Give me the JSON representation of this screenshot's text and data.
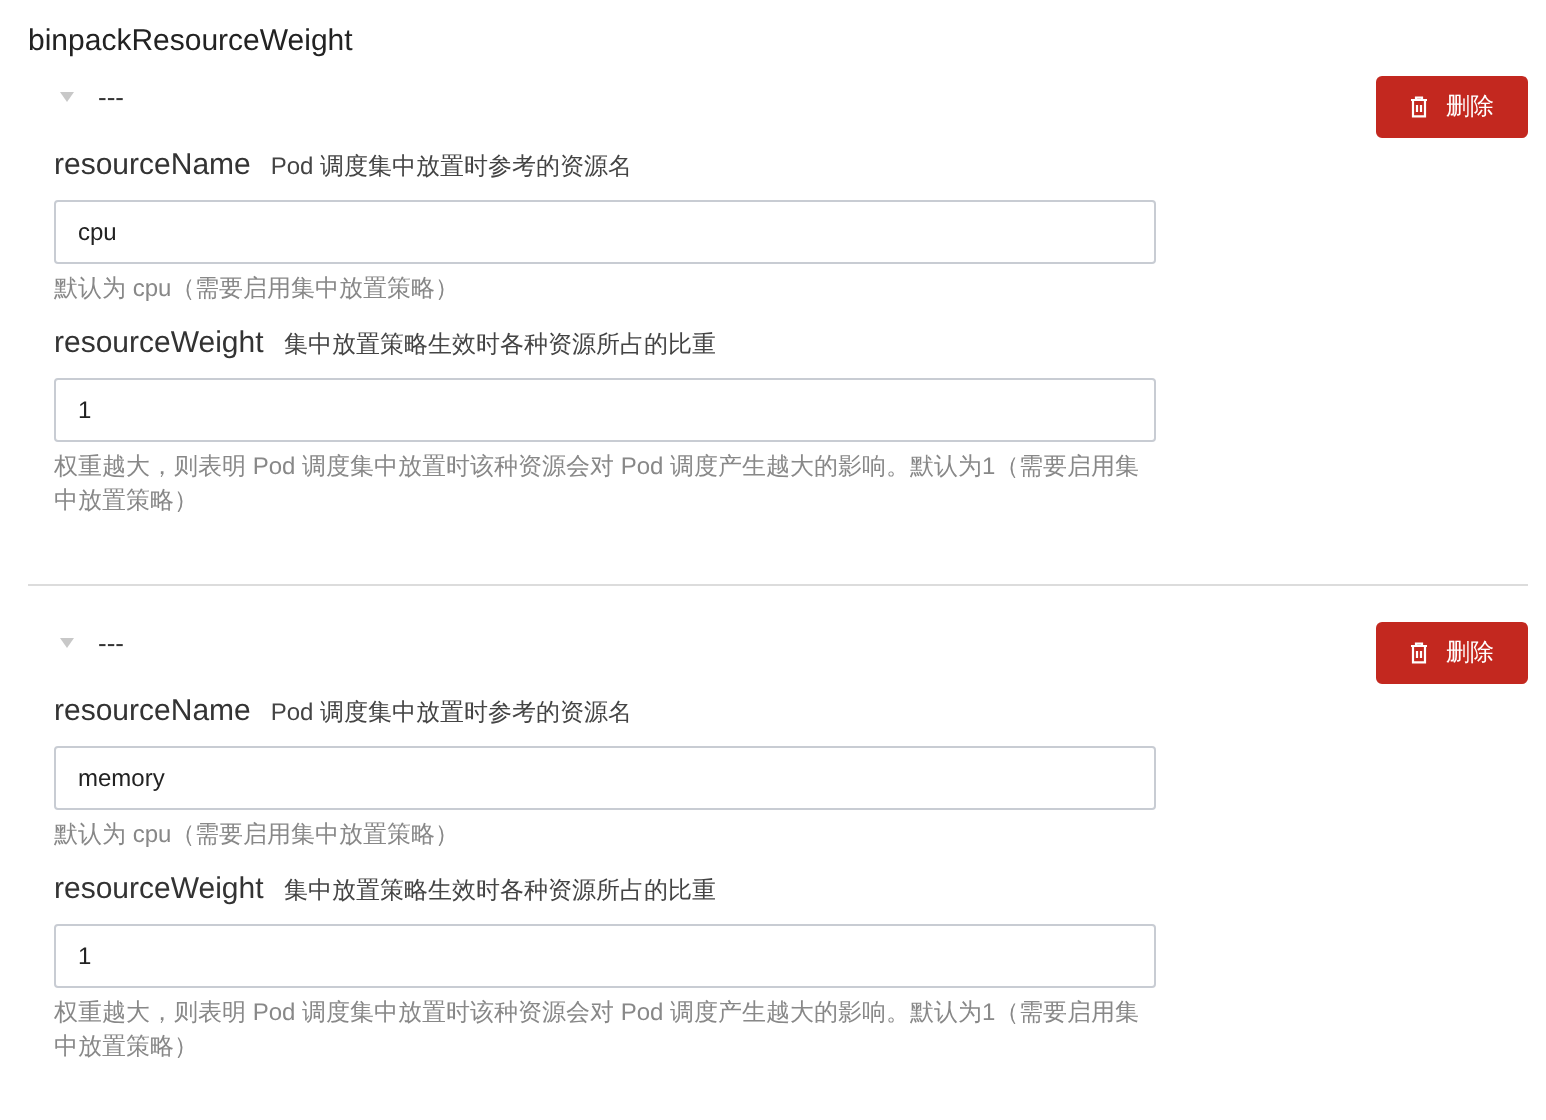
{
  "title": "binpackResourceWeight",
  "items": [
    {
      "header": "---",
      "expanded": true,
      "delete_button": "删除",
      "fields": [
        {
          "name": "resourceName",
          "description": "Pod 调度集中放置时参考的资源名",
          "value": "cpu",
          "help": "默认为 cpu（需要启用集中放置策略）"
        },
        {
          "name": "resourceWeight",
          "description": "集中放置策略生效时各种资源所占的比重",
          "value": "1",
          "help": "权重越大，则表明 Pod 调度集中放置时该种资源会对 Pod 调度产生越大的影响。默认为1（需要启用集中放置策略）"
        }
      ]
    },
    {
      "header": "---",
      "expanded": true,
      "delete_button": "删除",
      "fields": [
        {
          "name": "resourceName",
          "description": "Pod 调度集中放置时参考的资源名",
          "value": "memory",
          "help": "默认为 cpu（需要启用集中放置策略）"
        },
        {
          "name": "resourceWeight",
          "description": "集中放置策略生效时各种资源所占的比重",
          "value": "1",
          "help": "权重越大，则表明 Pod 调度集中放置时该种资源会对 Pod 调度产生越大的影响。默认为1（需要启用集中放置策略）"
        }
      ]
    }
  ]
}
